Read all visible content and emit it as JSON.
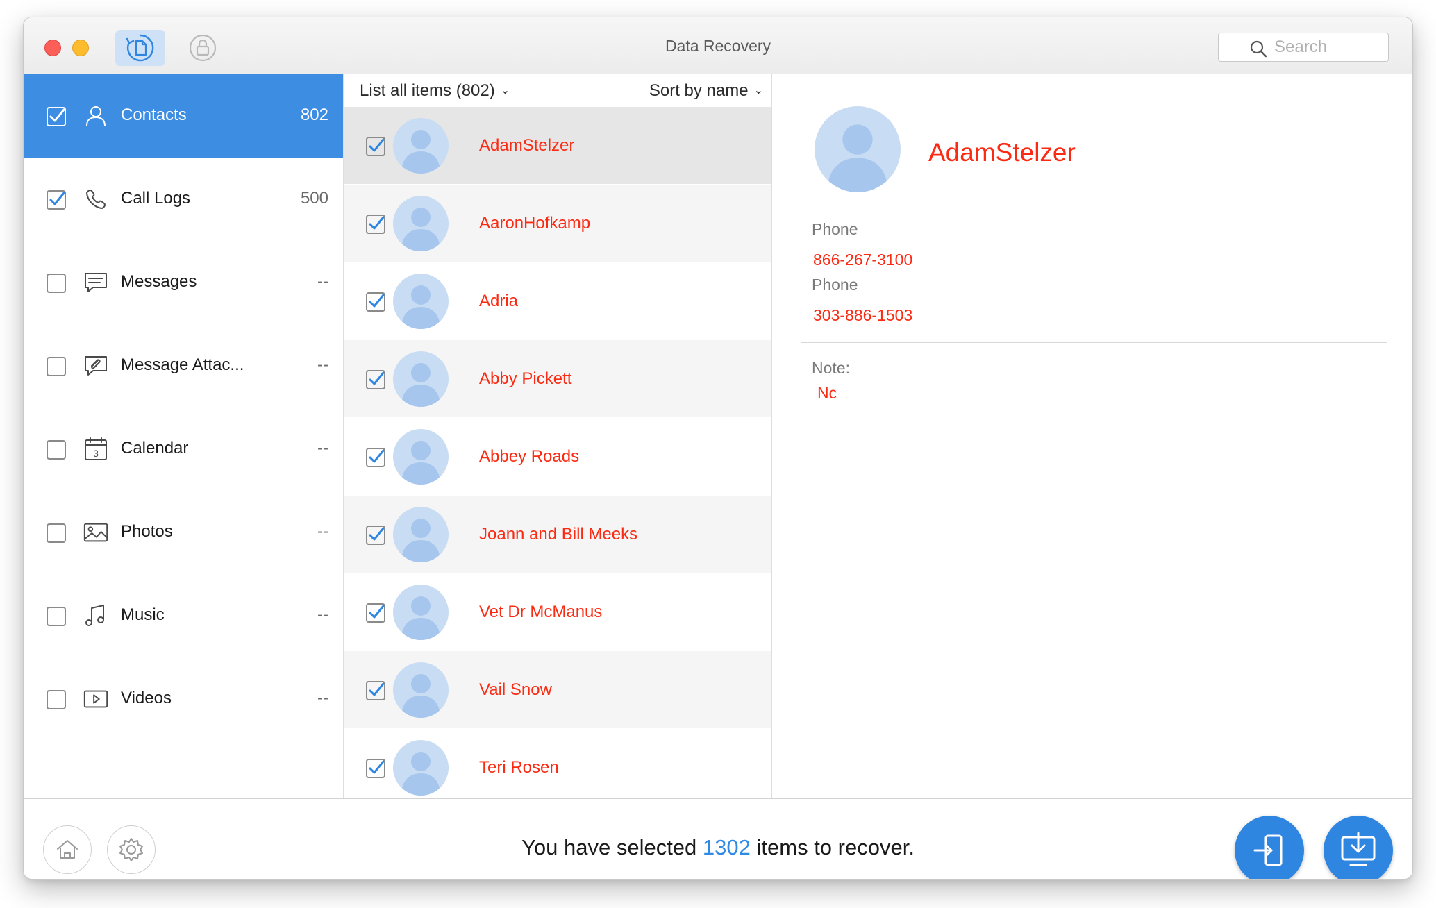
{
  "window": {
    "title": "Data Recovery"
  },
  "search": {
    "placeholder": "Search"
  },
  "sidebar": {
    "items": [
      {
        "label": "Contacts",
        "count": "802",
        "checked": true,
        "icon": "person-icon",
        "selected": true
      },
      {
        "label": "Call Logs",
        "count": "500",
        "checked": true,
        "icon": "phone-icon",
        "selected": false
      },
      {
        "label": "Messages",
        "count": "--",
        "checked": false,
        "icon": "message-icon",
        "selected": false
      },
      {
        "label": "Message Attac...",
        "count": "--",
        "checked": false,
        "icon": "attachment-icon",
        "selected": false
      },
      {
        "label": "Calendar",
        "count": "--",
        "checked": false,
        "icon": "calendar-icon",
        "selected": false
      },
      {
        "label": "Photos",
        "count": "--",
        "checked": false,
        "icon": "photo-icon",
        "selected": false
      },
      {
        "label": "Music",
        "count": "--",
        "checked": false,
        "icon": "music-icon",
        "selected": false
      },
      {
        "label": "Videos",
        "count": "--",
        "checked": false,
        "icon": "video-icon",
        "selected": false
      }
    ]
  },
  "list": {
    "filter_label": "List all items (802)",
    "sort_label": "Sort by name",
    "rows": [
      {
        "name": "AdamStelzer",
        "checked": true,
        "selected": true
      },
      {
        "name": "AaronHofkamp",
        "checked": true
      },
      {
        "name": "Adria",
        "checked": true
      },
      {
        "name": "Abby Pickett",
        "checked": true
      },
      {
        "name": "Abbey Roads",
        "checked": true
      },
      {
        "name": "Joann and Bill Meeks",
        "checked": true
      },
      {
        "name": "Vet Dr McManus",
        "checked": true
      },
      {
        "name": "Vail Snow",
        "checked": true
      },
      {
        "name": "Teri Rosen",
        "checked": true
      }
    ]
  },
  "detail": {
    "name": "AdamStelzer",
    "phone1_label": "Phone",
    "phone1_value": "866-267-3100",
    "phone2_label": "Phone",
    "phone2_value": "303-886-1503",
    "note_label": "Note:",
    "note_value": "Nc"
  },
  "status": {
    "prefix": "You have selected",
    "count": "1302",
    "suffix": "items to recover."
  },
  "colors": {
    "accent": "#3d8ee2",
    "contact_name": "#fb2a12",
    "count_highlight": "#2f8ae4"
  }
}
